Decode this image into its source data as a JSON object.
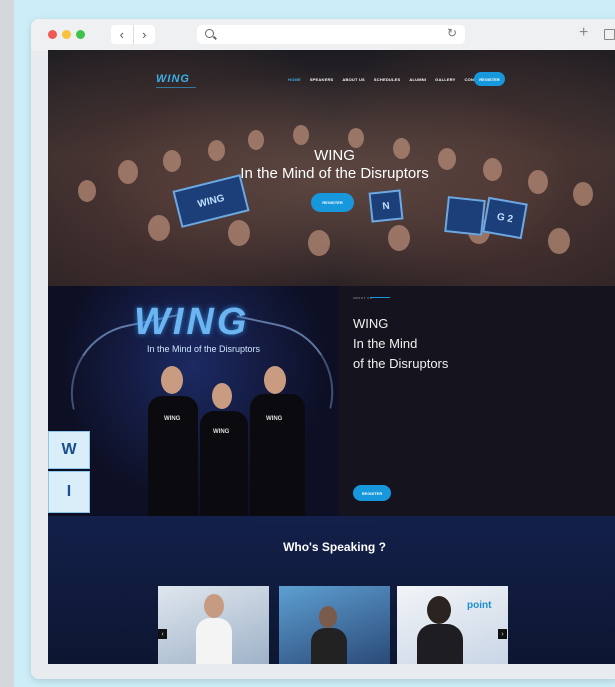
{
  "browser": {
    "back_glyph": "‹",
    "forward_glyph": "›",
    "reload_glyph": "↻",
    "new_tab_glyph": "+",
    "url": ""
  },
  "nav": {
    "logo": "WING",
    "items": [
      "HOME",
      "SPEAKERS",
      "ABOUT US",
      "SCHEDULES",
      "ALUMNI",
      "GALLERY",
      "CONTACT US"
    ],
    "register": "REGISTER"
  },
  "hero": {
    "title_line1": "WING",
    "title_line2": "In the Mind of the Disruptors",
    "register": "REGISTER",
    "sign_left": "WING",
    "sign_n": "N",
    "sign_g2": "G 2",
    "sign_blank": ""
  },
  "about": {
    "image_logo": "WING",
    "image_subtitle": "In the Mind of the Disruptors",
    "shirt_text": "WING",
    "cube_w": "W",
    "cube_i": "I",
    "label": "ABOUT US",
    "title_line1": "WING",
    "title_line2": "In the Mind",
    "title_line3": "of the Disruptors",
    "body": "",
    "register": "REGISTER"
  },
  "speakers": {
    "title": "Who's Speaking ?",
    "prev": "‹",
    "next": "›",
    "cards": [
      {
        "caption": ""
      },
      {
        "caption": ""
      },
      {
        "caption": "point"
      }
    ]
  },
  "colors": {
    "accent": "#1898dc",
    "page_bg": "#cdeef8",
    "dark_bg": "#15131d"
  }
}
